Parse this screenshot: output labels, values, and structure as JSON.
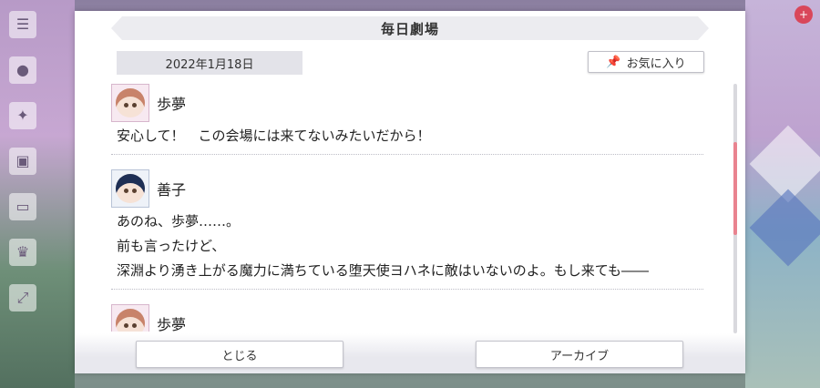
{
  "dialog": {
    "title": "毎日劇場",
    "date": "2022年1月18日",
    "favorite_label": "お気に入り"
  },
  "messages": [
    {
      "speaker": "歩夢",
      "avatar": "ayumu",
      "lines": [
        "安心して！　この会場には来てないみたいだから！"
      ]
    },
    {
      "speaker": "善子",
      "avatar": "yoshiko",
      "lines": [
        "あのね、歩夢……。",
        "前も言ったけど、",
        "深淵より湧き上がる魔力に満ちている堕天使ヨハネに敵はいないのよ。もし来ても――"
      ]
    },
    {
      "speaker": "歩夢",
      "avatar": "ayumu",
      "lines": []
    }
  ],
  "buttons": {
    "close_label": "とじる",
    "archive_label": "アーカイブ"
  },
  "scroll": {
    "position_fraction": 0.37
  },
  "colors": {
    "accent": "#e9838f"
  }
}
